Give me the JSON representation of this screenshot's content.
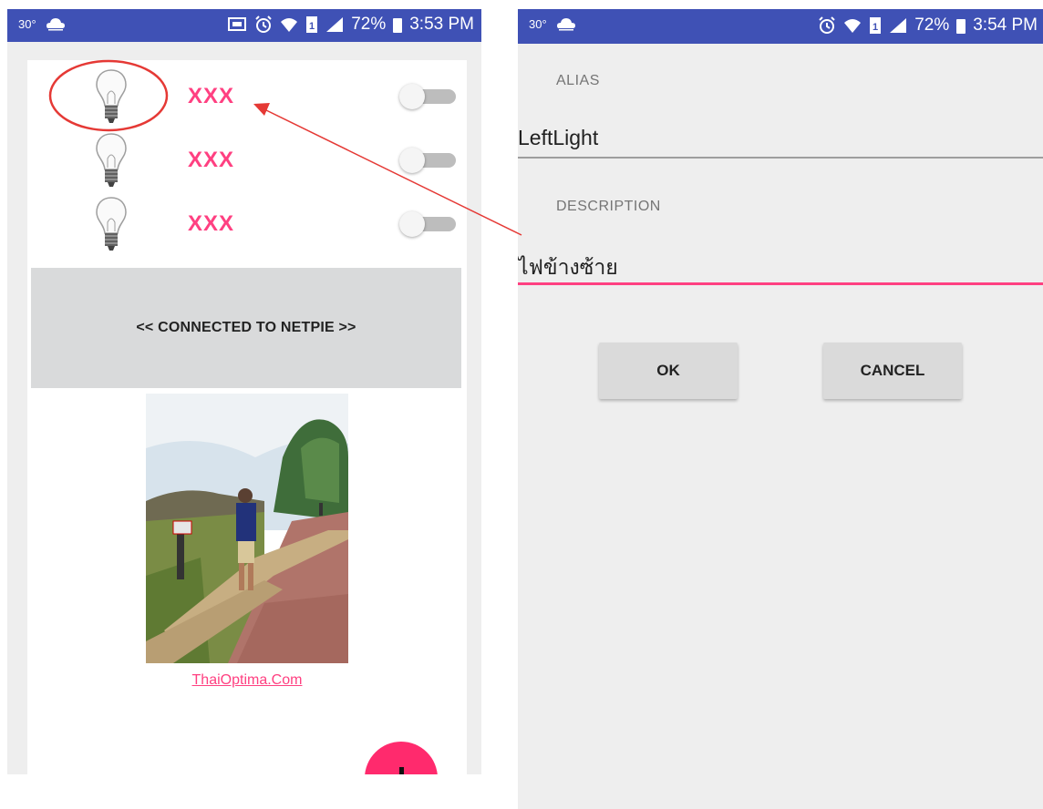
{
  "colors": {
    "status_bar": "#3f51b5",
    "accent": "#ff4081",
    "annotation": "#e53935",
    "screen_bg": "#eeeeee"
  },
  "left_screen": {
    "status_bar": {
      "temperature": "30°",
      "weather_icon": "weather-cloud-icon",
      "icons": [
        "screen-cast-icon",
        "alarm-icon",
        "wifi-icon",
        "sim-icon",
        "signal-icon"
      ],
      "battery": "72%",
      "time": "3:53 PM"
    },
    "lights": [
      {
        "name": "XXX",
        "icon": "light-bulb-icon",
        "switch_on": false
      },
      {
        "name": "XXX",
        "icon": "light-bulb-icon",
        "switch_on": false
      },
      {
        "name": "XXX",
        "icon": "light-bulb-icon",
        "switch_on": false
      }
    ],
    "connection_status": "<< CONNECTED TO NETPIE >>",
    "photo_icon": "person-photo-image",
    "link_text": "ThaiOptima.Com",
    "fab_icon": "plus-icon"
  },
  "right_screen": {
    "status_bar": {
      "temperature": "30°",
      "weather_icon": "weather-cloud-icon",
      "icons": [
        "alarm-icon",
        "wifi-icon",
        "sim-icon",
        "signal-icon"
      ],
      "battery": "72%",
      "time": "3:54 PM"
    },
    "dialog": {
      "alias_label": "ALIAS",
      "alias_value": "LeftLight",
      "description_label": "DESCRIPTION",
      "description_value": "ไฟข้างซ้าย",
      "ok_label": "OK",
      "cancel_label": "CANCEL"
    }
  }
}
